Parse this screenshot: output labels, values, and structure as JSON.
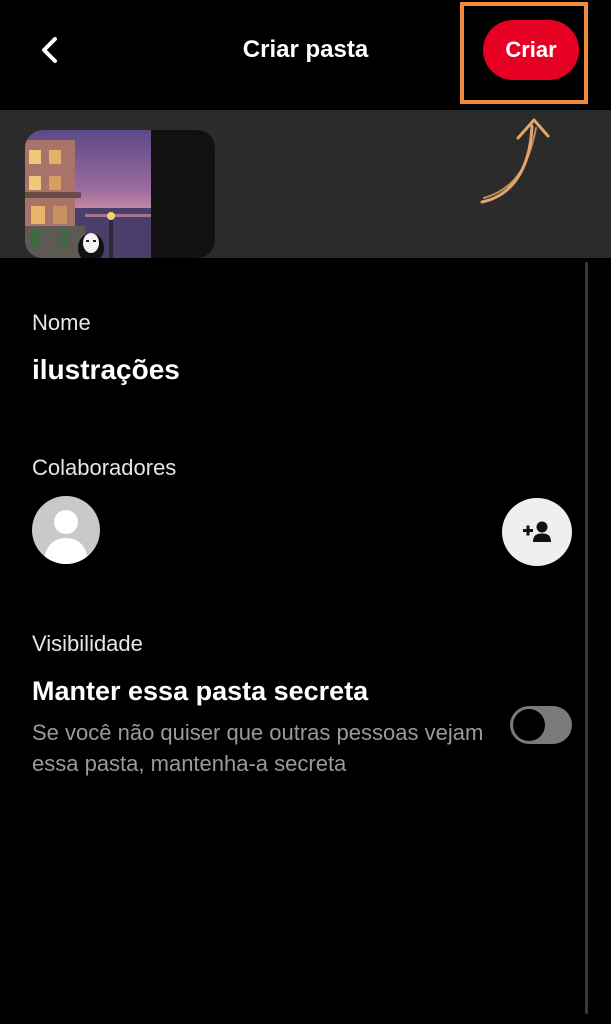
{
  "header": {
    "title": "Criar pasta",
    "back_icon": "chevron-left-icon",
    "create_label": "Criar",
    "accent_color": "#e60023",
    "highlight_color": "#ef8a3c"
  },
  "form": {
    "name": {
      "label": "Nome",
      "value": "ilustrações"
    },
    "collaborators": {
      "label": "Colaboradores",
      "avatar_icon": "user-silhouette-icon",
      "add_icon": "add-person-icon"
    },
    "visibility": {
      "label": "Visibilidade",
      "secret_title": "Manter essa pasta secreta",
      "secret_description": "Se você não quiser que outras pessoas vejam essa pasta, mantenha-a secreta",
      "secret_enabled": false
    }
  }
}
